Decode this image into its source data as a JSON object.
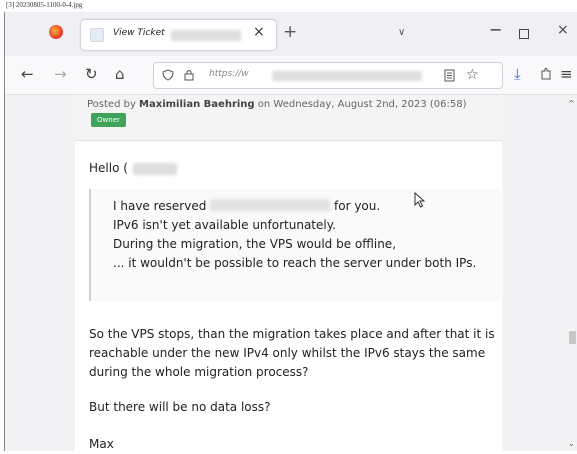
{
  "caption": "[3] 20230805-1100-0-4.jpg",
  "browser": {
    "tab": {
      "title": "View Ticket",
      "close_glyph": "×"
    },
    "new_tab_glyph": "+",
    "tab_list_glyph": "∨",
    "window": {
      "minimize_glyph": "−",
      "close_glyph": "×"
    },
    "nav": {
      "back_glyph": "←",
      "forward_glyph": "→",
      "reload_glyph": "↻",
      "home_glyph": "⌂",
      "bookmark_glyph": "☆",
      "download_glyph": "⤓",
      "overflow_glyph": "»",
      "menu_glyph": "≡"
    },
    "url": "https://w"
  },
  "post": {
    "posted_prefix": "Posted by ",
    "author": "Maximilian Baehring",
    "posted_on": " on Wednesday, August 2nd, 2023 (06:58)",
    "badge": "Owner",
    "greeting": "Hello (",
    "quote": {
      "line1_before": "I have reserved",
      "line1_after": "for you.",
      "line2": "IPv6 isn't yet available unfortunately.",
      "line3": "During the migration, the VPS would be offline,",
      "line4": "... it wouldn't be possible to reach the server under both IPs."
    },
    "paragraph1": "So the VPS stops, than the migration takes place and after that it is reachable under the new IPv4 only whilst the IPv6 stays the same during the whole migration process?",
    "paragraph2": "But there will be no data loss?",
    "signature": "Max"
  },
  "scrollbar": {
    "up_glyph": "^",
    "down_glyph": "⌄"
  },
  "colors": {
    "owner_badge": "#3fa35a",
    "chrome": "#f0f0f4"
  }
}
